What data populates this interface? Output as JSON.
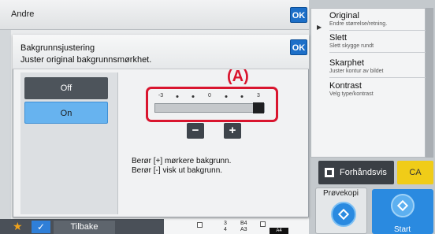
{
  "topbar": {
    "title": "Andre",
    "ok_label": "OK"
  },
  "dialog": {
    "title": "Bakgrunnsjustering",
    "subtitle": "Juster original bakgrunnsmørkhet.",
    "ok_label": "OK",
    "off_label": "Off",
    "on_label": "On",
    "selected": "On",
    "callout_label": "(A)",
    "slider": {
      "ticks": [
        "-3",
        "•",
        "•",
        "0",
        "•",
        "•",
        "3"
      ],
      "min": -3,
      "max": 3,
      "value": 3
    },
    "minus_label": "−",
    "plus_label": "+",
    "help_line1": "Berør [+] mørkere bakgrunn.",
    "help_line2": "Berør [-] visk ut bakgrunn."
  },
  "features": [
    {
      "title": "Original",
      "sub": "Endre størrelse/retning."
    },
    {
      "title": "Slett",
      "sub": "Slett skygge rundt"
    },
    {
      "title": "Skarphet",
      "sub": "Juster kontur av bildet"
    },
    {
      "title": "Kontrast",
      "sub": "Velg type/kontrast"
    }
  ],
  "actions": {
    "preview_label": "Forhåndsvis",
    "ca_label": "CA",
    "proof_label": "Prøvekopi",
    "start_label": "Start"
  },
  "bottombar": {
    "back_label": "Tilbake",
    "trays": [
      {
        "num": "3",
        "size": "B4"
      },
      {
        "num": "4",
        "size": "A3"
      }
    ],
    "tray_selected": "A4"
  },
  "colors": {
    "accent_blue": "#1d6fc8",
    "on_selected": "#67b3ef",
    "callout_red": "#d9152e",
    "ca_yellow": "#f0cc18",
    "start_blue": "#2a8ae0"
  }
}
